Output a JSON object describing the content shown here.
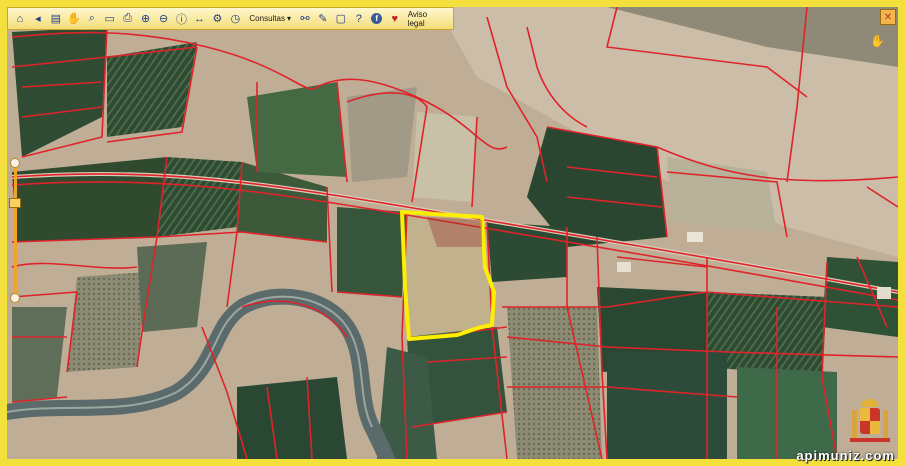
{
  "toolbar": {
    "consultas_label": "Consultas",
    "aviso_legal_label": "Aviso legal",
    "icons": [
      "home-icon",
      "back-icon",
      "layers-icon",
      "hand-icon",
      "search-icon",
      "folder-icon",
      "print-icon",
      "zoom-in-icon",
      "zoom-out-icon",
      "info-icon",
      "measure-icon",
      "gear-icon",
      "clock-icon",
      "binoculars-icon",
      "pencil-icon",
      "window-icon",
      "help-icon",
      "facebook-icon",
      "heart-icon"
    ]
  },
  "map": {
    "type": "aerial orthophoto with cadastral parcels",
    "parcel_line_color": "#e0232a",
    "selection_outline_color": "#ffee00",
    "river_color": "#5b6a6a"
  },
  "watermark": "apimuniz.com",
  "colors": {
    "frame": "#f4e03c",
    "toolbar_bg": "#f3dd78"
  }
}
